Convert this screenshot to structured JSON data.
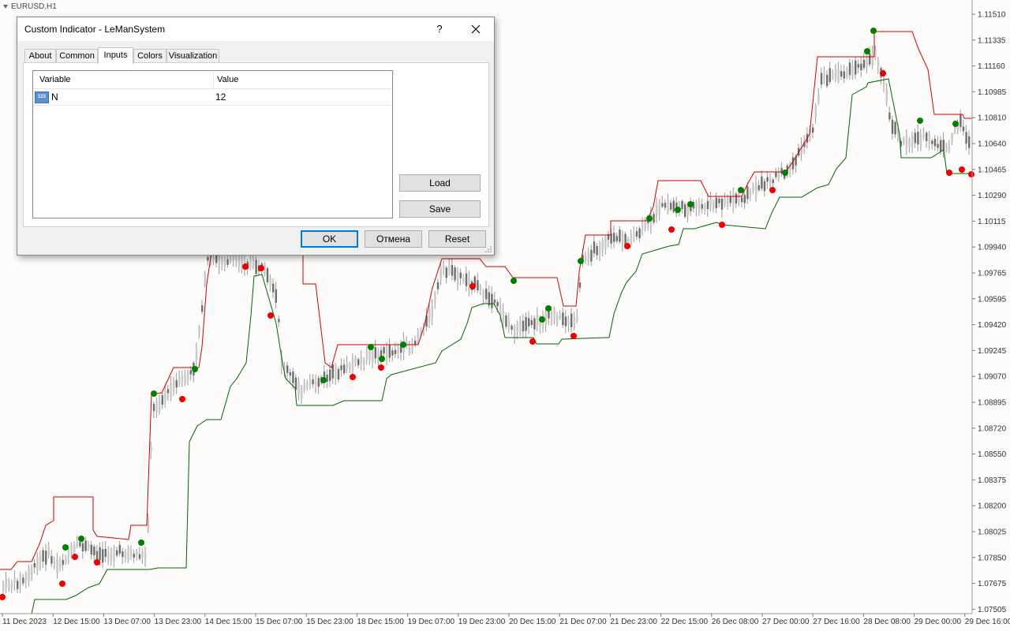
{
  "chart": {
    "symbol": "EURUSD,H1",
    "colors": {
      "background": "#fdfcfa",
      "upper_channel": "#cc0000",
      "lower_channel": "#006400",
      "buy_dot": "#008000",
      "sell_dot": "#ee0000",
      "candle": "#808080"
    },
    "price_labels": [
      "1.11510",
      "1.11335",
      "1.11160",
      "1.10985",
      "1.10810",
      "1.10640",
      "1.10465",
      "1.10290",
      "1.10115",
      "1.09940",
      "1.09765",
      "1.09595",
      "1.09420",
      "1.09245",
      "1.09070",
      "1.08895",
      "1.08720",
      "1.08550",
      "1.08375",
      "1.08200",
      "1.08025",
      "1.07850",
      "1.07675",
      "1.07505"
    ],
    "time_labels": [
      "11 Dec 2023",
      "12 Dec 15:00",
      "13 Dec 07:00",
      "13 Dec 23:00",
      "14 Dec 15:00",
      "15 Dec 07:00",
      "15 Dec 23:00",
      "18 Dec 15:00",
      "19 Dec 07:00",
      "19 Dec 23:00",
      "20 Dec 15:00",
      "21 Dec 07:00",
      "21 Dec 23:00",
      "22 Dec 15:00",
      "26 Dec 08:00",
      "27 Dec 00:00",
      "27 Dec 16:00",
      "28 Dec 08:00",
      "29 Dec 00:00",
      "29 Dec 16:00"
    ]
  },
  "dialog": {
    "title": "Custom Indicator - LeManSystem",
    "help": "?",
    "tabs": [
      "About",
      "Common",
      "Inputs",
      "Colors",
      "Visualization"
    ],
    "active_tab": "Inputs",
    "grid": {
      "col_variable": "Variable",
      "col_value": "Value",
      "rows": [
        {
          "icon": "123",
          "variable": "N",
          "value": "12"
        }
      ]
    },
    "buttons": {
      "load": "Load",
      "save": "Save",
      "ok": "OK",
      "cancel": "Отмена",
      "reset": "Reset"
    }
  }
}
